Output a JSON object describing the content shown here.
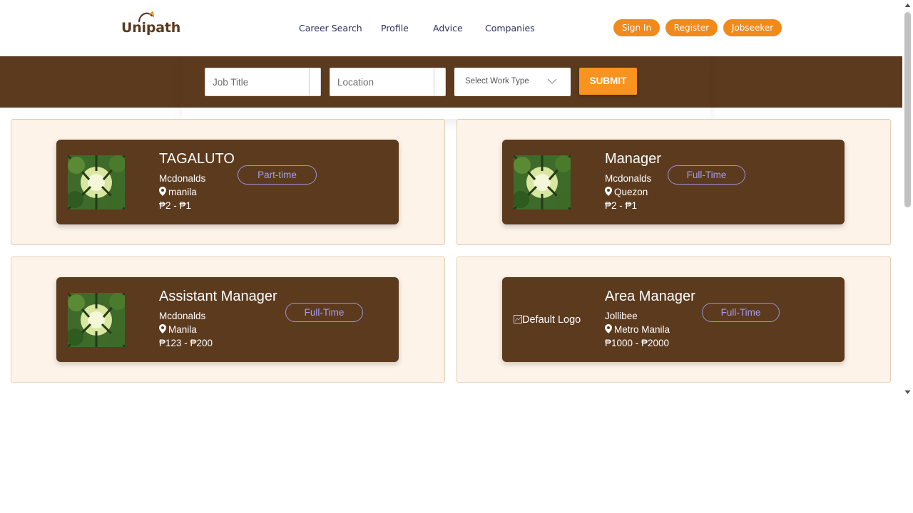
{
  "brand": {
    "name": "Unipath",
    "accent": "#f08a1c",
    "primary": "#5c3a1e"
  },
  "nav": {
    "items": [
      "Career Search",
      "Profile",
      "Advice",
      "Companies"
    ]
  },
  "auth": {
    "sign_in": "Sign In",
    "register": "Register",
    "jobseeker": "Jobseeker"
  },
  "search": {
    "job_title_placeholder": "Job Title",
    "location_placeholder": "Location",
    "work_type_selected": "Select Work Type",
    "submit_label": "SUBMIT"
  },
  "jobs": [
    {
      "title": "TAGALUTO",
      "company": "Mcdonalds",
      "location": "manila",
      "salary": "₱2 - ₱1",
      "type": "Part-time",
      "image": "forest-canopy"
    },
    {
      "title": "Manager",
      "company": "Mcdonalds",
      "location": "Quezon",
      "salary": "₱2 - ₱1",
      "type": "Full-Time",
      "image": "forest-canopy"
    },
    {
      "title": "Assistant Manager",
      "company": "Mcdonalds",
      "location": "Manila",
      "salary": "₱123 - ₱200",
      "type": "Full-Time",
      "image": "forest-canopy"
    },
    {
      "title": "Area Manager",
      "company": "Jollibee",
      "location": "Metro Manila",
      "salary": "₱1000 - ₱2000",
      "type": "Full-Time",
      "image_alt": "Default Logo"
    }
  ]
}
